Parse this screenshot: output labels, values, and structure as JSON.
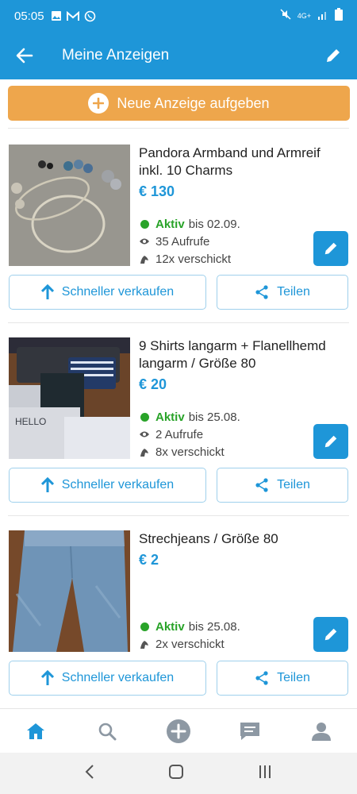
{
  "status_bar": {
    "time": "05:05",
    "network": "4G+"
  },
  "app_bar": {
    "title": "Meine Anzeigen"
  },
  "new_ad": {
    "label": "Neue Anzeige aufgeben"
  },
  "colors": {
    "primary": "#1e96d8",
    "accent": "#eea64c",
    "active": "#29a329"
  },
  "listings": [
    {
      "title": "Pandora Armband und Armreif inkl. 10 Charms",
      "price": "€ 130",
      "status": "Aktiv",
      "until": "bis 02.09.",
      "views": "35 Aufrufe",
      "sent": "12x verschickt",
      "sell_label": "Schneller verkaufen",
      "share_label": "Teilen"
    },
    {
      "title": "9 Shirts langarm + Flanellhemd langarm / Größe 80",
      "price": "€ 20",
      "status": "Aktiv",
      "until": "bis 25.08.",
      "views": "2 Aufrufe",
      "sent": "8x verschickt",
      "sell_label": "Schneller verkaufen",
      "share_label": "Teilen"
    },
    {
      "title": "Strechjeans / Größe 80",
      "price": "€ 2",
      "status": "Aktiv",
      "until": "bis 25.08.",
      "sent": "2x verschickt",
      "sell_label": "Schneller verkaufen",
      "share_label": "Teilen"
    }
  ],
  "bottom_nav": [
    "home-icon",
    "search-icon",
    "add-icon",
    "messages-icon",
    "profile-icon"
  ]
}
